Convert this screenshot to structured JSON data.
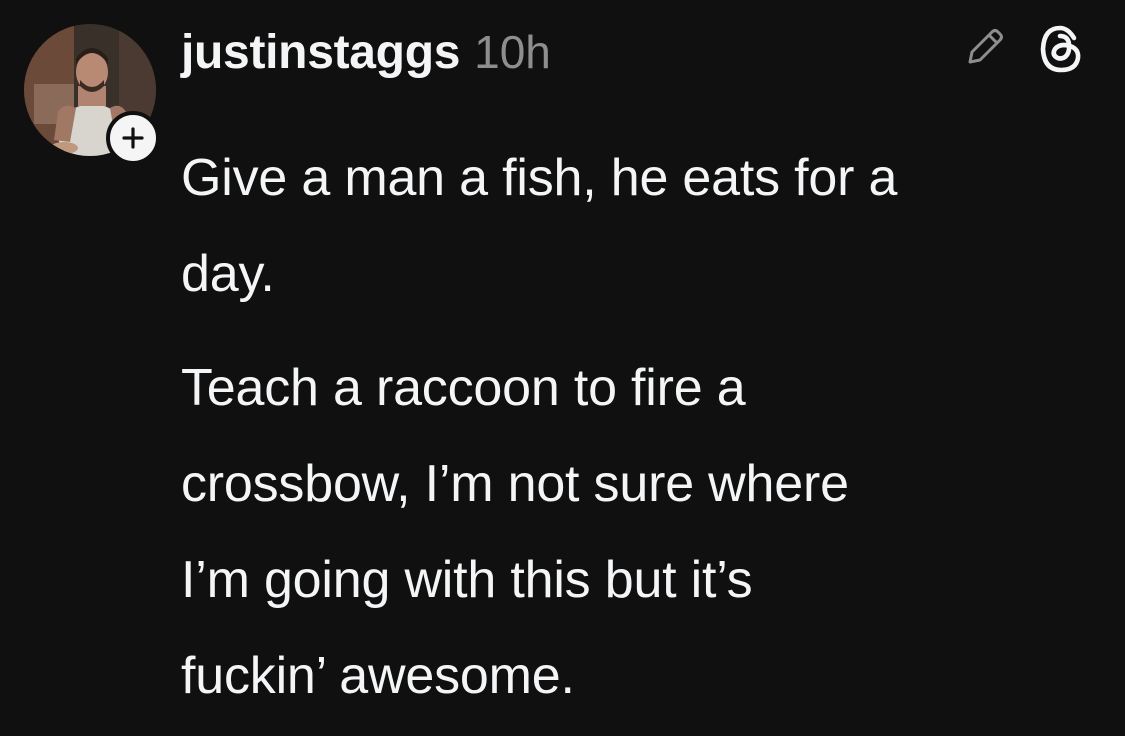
{
  "post": {
    "username": "justinstaggs",
    "timestamp": "10h",
    "paragraphs": [
      "Give a man a fish, he eats for a\nday.",
      "Teach a raccoon to fire a\ncrossbow, I’m not sure where\nI’m going with this but it’s\nfuckin’ awesome."
    ]
  },
  "icons": {
    "follow": "plus-icon",
    "edit": "pencil-icon",
    "app": "threads-logo-icon"
  },
  "colors": {
    "background": "#101010",
    "text": "#f3f5f7",
    "secondary_text": "#8e8e8e",
    "badge_background": "#f5f5f5"
  }
}
